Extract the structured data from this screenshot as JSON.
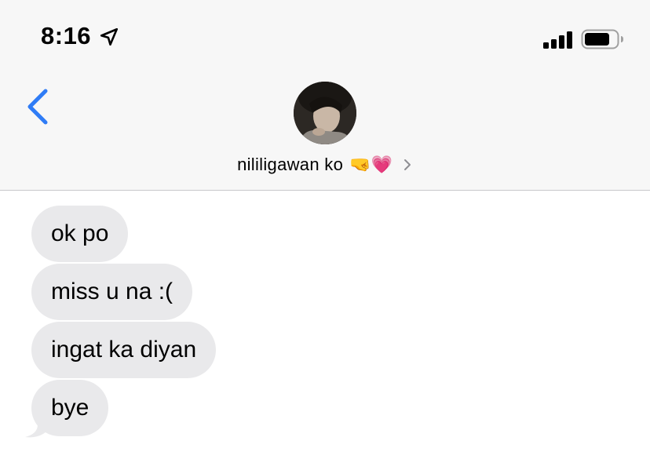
{
  "status_bar": {
    "time": "8:16",
    "icons": [
      "location-arrow-icon",
      "cellular-signal-icon",
      "battery-icon"
    ]
  },
  "nav": {
    "back_icon": "chevron-left-icon",
    "contact_name": "nililigawan ko",
    "contact_emoji": "🤜💗",
    "disclosure_icon": "chevron-right-icon",
    "accent_color": "#2f7cf6"
  },
  "messages": [
    {
      "text": "ok po",
      "direction": "incoming"
    },
    {
      "text": "miss u na :(",
      "direction": "incoming"
    },
    {
      "text": "ingat ka diyan",
      "direction": "incoming"
    },
    {
      "text": "bye",
      "direction": "incoming"
    }
  ],
  "colors": {
    "header_bg": "#f7f7f7",
    "incoming_bubble": "#e9e9eb",
    "text": "#000000"
  }
}
